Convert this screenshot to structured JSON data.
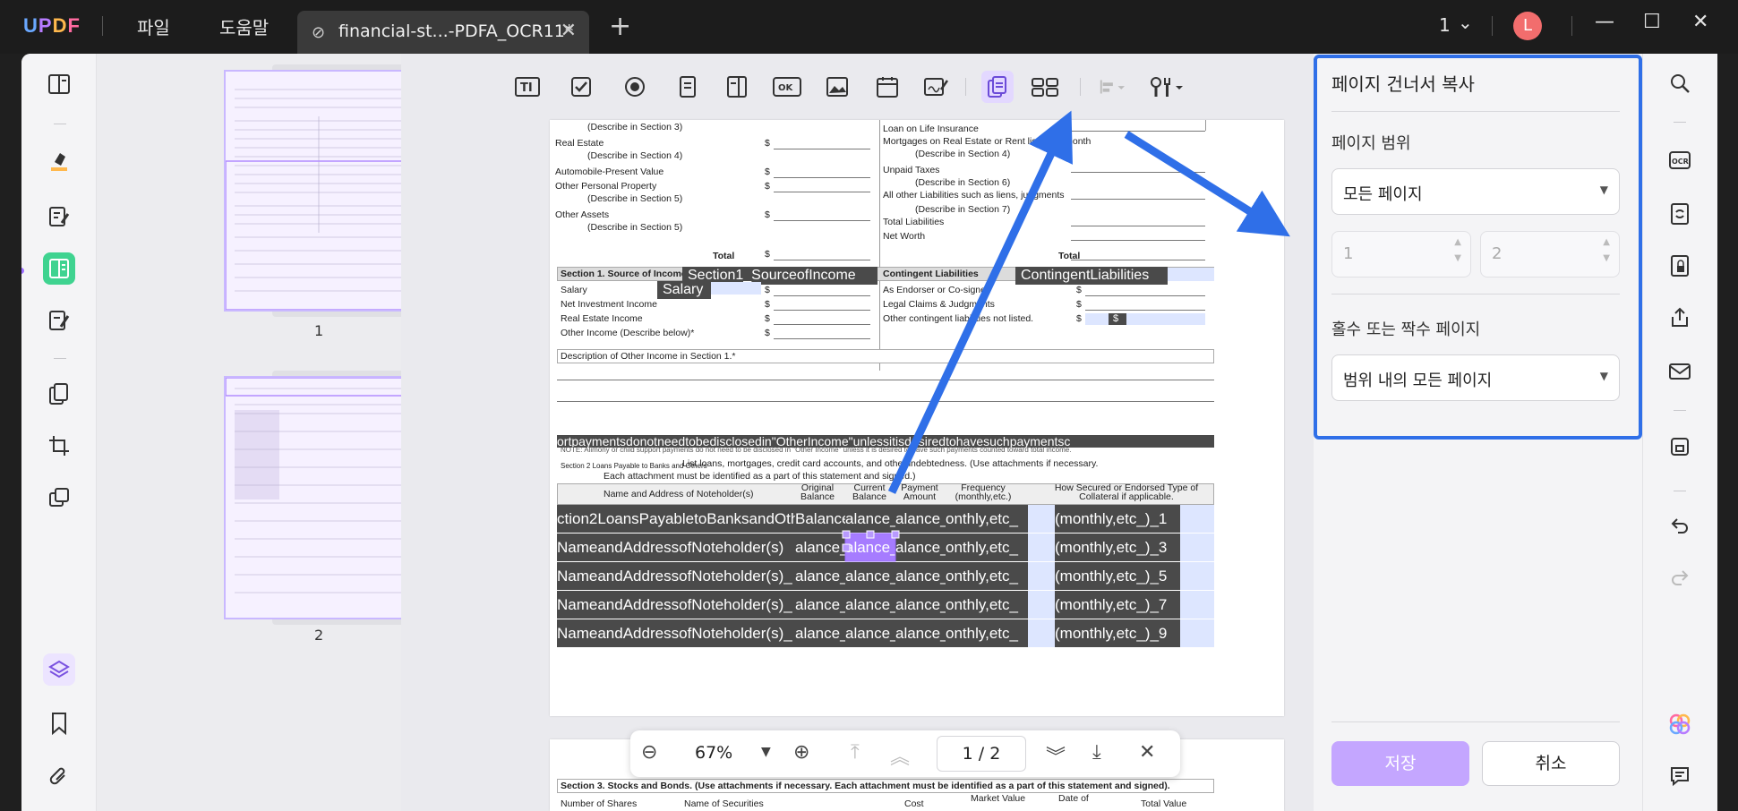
{
  "app": {
    "logo": {
      "u": "U",
      "p": "P",
      "d": "D",
      "f": "F"
    },
    "menus": [
      "파일",
      "도움말"
    ],
    "tab_title": "financial-st...-PDFA_OCR11*",
    "page_indicator": "1",
    "avatar_initial": "L"
  },
  "thumbnails": [
    {
      "label": "1"
    },
    {
      "label": "2"
    }
  ],
  "zoom": {
    "value": "67%",
    "current_page": "1",
    "separator": "/",
    "total_pages": "2"
  },
  "panel": {
    "title": "페이지 건너서 복사",
    "range_label": "페이지 범위",
    "range_value": "모든 페이지",
    "from_value": "1",
    "to_value": "2",
    "odd_even_label": "홀수 또는 짝수 페이지",
    "odd_even_value": "범위 내의 모든 페이지",
    "save_label": "저장",
    "cancel_label": "취소"
  },
  "document": {
    "left_col": [
      "(Describe in Section 3)",
      "Real Estate",
      "(Describe in Section 4)",
      "Automobile-Present Value",
      "Other Personal Property",
      "(Describe in Section 5)",
      "Other Assets",
      "(Describe in Section 5)",
      "Total"
    ],
    "right_col": [
      "Loan on Life Insurance",
      "Mortgages on Real Estate or Rent listed by month",
      "(Describe in Section 4)",
      "Unpaid Taxes",
      "(Describe in Section 6)",
      "All other Liabilities such as liens, judgments",
      "(Describe in Section 7)",
      "Total Liabilities",
      "Net Worth",
      "Total"
    ],
    "section1_title": "Section 1. Source of Income",
    "section1_field": "Section1_SourceofIncome",
    "contingent_title": "Contingent Liabilities",
    "contingent_field": "ContingentLiabilities",
    "salary_field": "Salary",
    "income_rows": [
      "Salary",
      "Net Investment Income",
      "Real Estate Income",
      "Other Income (Describe below)*"
    ],
    "contingent_rows": [
      "As Endorser or Co-signer",
      "Legal Claims & Judgments",
      "Other contingent liabilities not listed."
    ],
    "dollar": "$",
    "other_income_desc": "Description of Other Income in Section 1.*",
    "note_field": "ortpaymentsdonotneedtobedisclosedin\"OtherIncome\"unlessitisdesiredtohavesuchpaymentsc",
    "note_text": "NOTE: Alimony or child support payments do not need to be disclosed in \"Other Income\" unless it is desired to have such payments counted toward total income.",
    "section2_lead": "Section 2 Loans Payable to Banks and Others",
    "section2_text": "List loans, mortgages, credit card accounts, and other indebtedness. (Use attachments if necessary.",
    "section2_text2": "Each attachment must be identified as a part of this statement and signed.)",
    "table_headers": [
      "Name and Address of Noteholder(s)",
      "Original Balance",
      "Current Balance",
      "Payment Amount",
      "Frequency (monthly,etc.)",
      "How Secured or Endorsed Type of Collateral if applicable."
    ],
    "rows": [
      [
        "ction2LoansPayabletoBanksandOth",
        "Balance",
        "alance_",
        "alance_",
        "onthly,etc_",
        "(monthly,etc_)_1"
      ],
      [
        "NameandAddressofNoteholder(s)",
        "alance_",
        "alance_",
        "alance_",
        "onthly,etc_",
        "(monthly,etc_)_3"
      ],
      [
        "NameandAddressofNoteholder(s)_",
        "alance_",
        "alance_",
        "alance_",
        "onthly,etc_",
        "(monthly,etc_)_5"
      ],
      [
        "NameandAddressofNoteholder(s)_",
        "alance_",
        "alance_",
        "alance_1",
        "onthly,etc_",
        "(monthly,etc_)_7"
      ],
      [
        "NameandAddressofNoteholder(s)_",
        "alance_1",
        "alance_",
        "alance_1",
        "onthly,etc_",
        "(monthly,etc_)_9"
      ]
    ],
    "section3_title": "Section 3. Stocks and Bonds. (Use attachments if necessary. Each attachment must be identified as a part of this statement and signed).",
    "section3_headers": [
      "Number of Shares",
      "Name of Securities",
      "Cost",
      "Market Value",
      "Date of",
      "Total Value"
    ]
  },
  "colors": {
    "accent": "#2f6fe8",
    "purple": "#a67cff",
    "green": "#3fd390"
  }
}
